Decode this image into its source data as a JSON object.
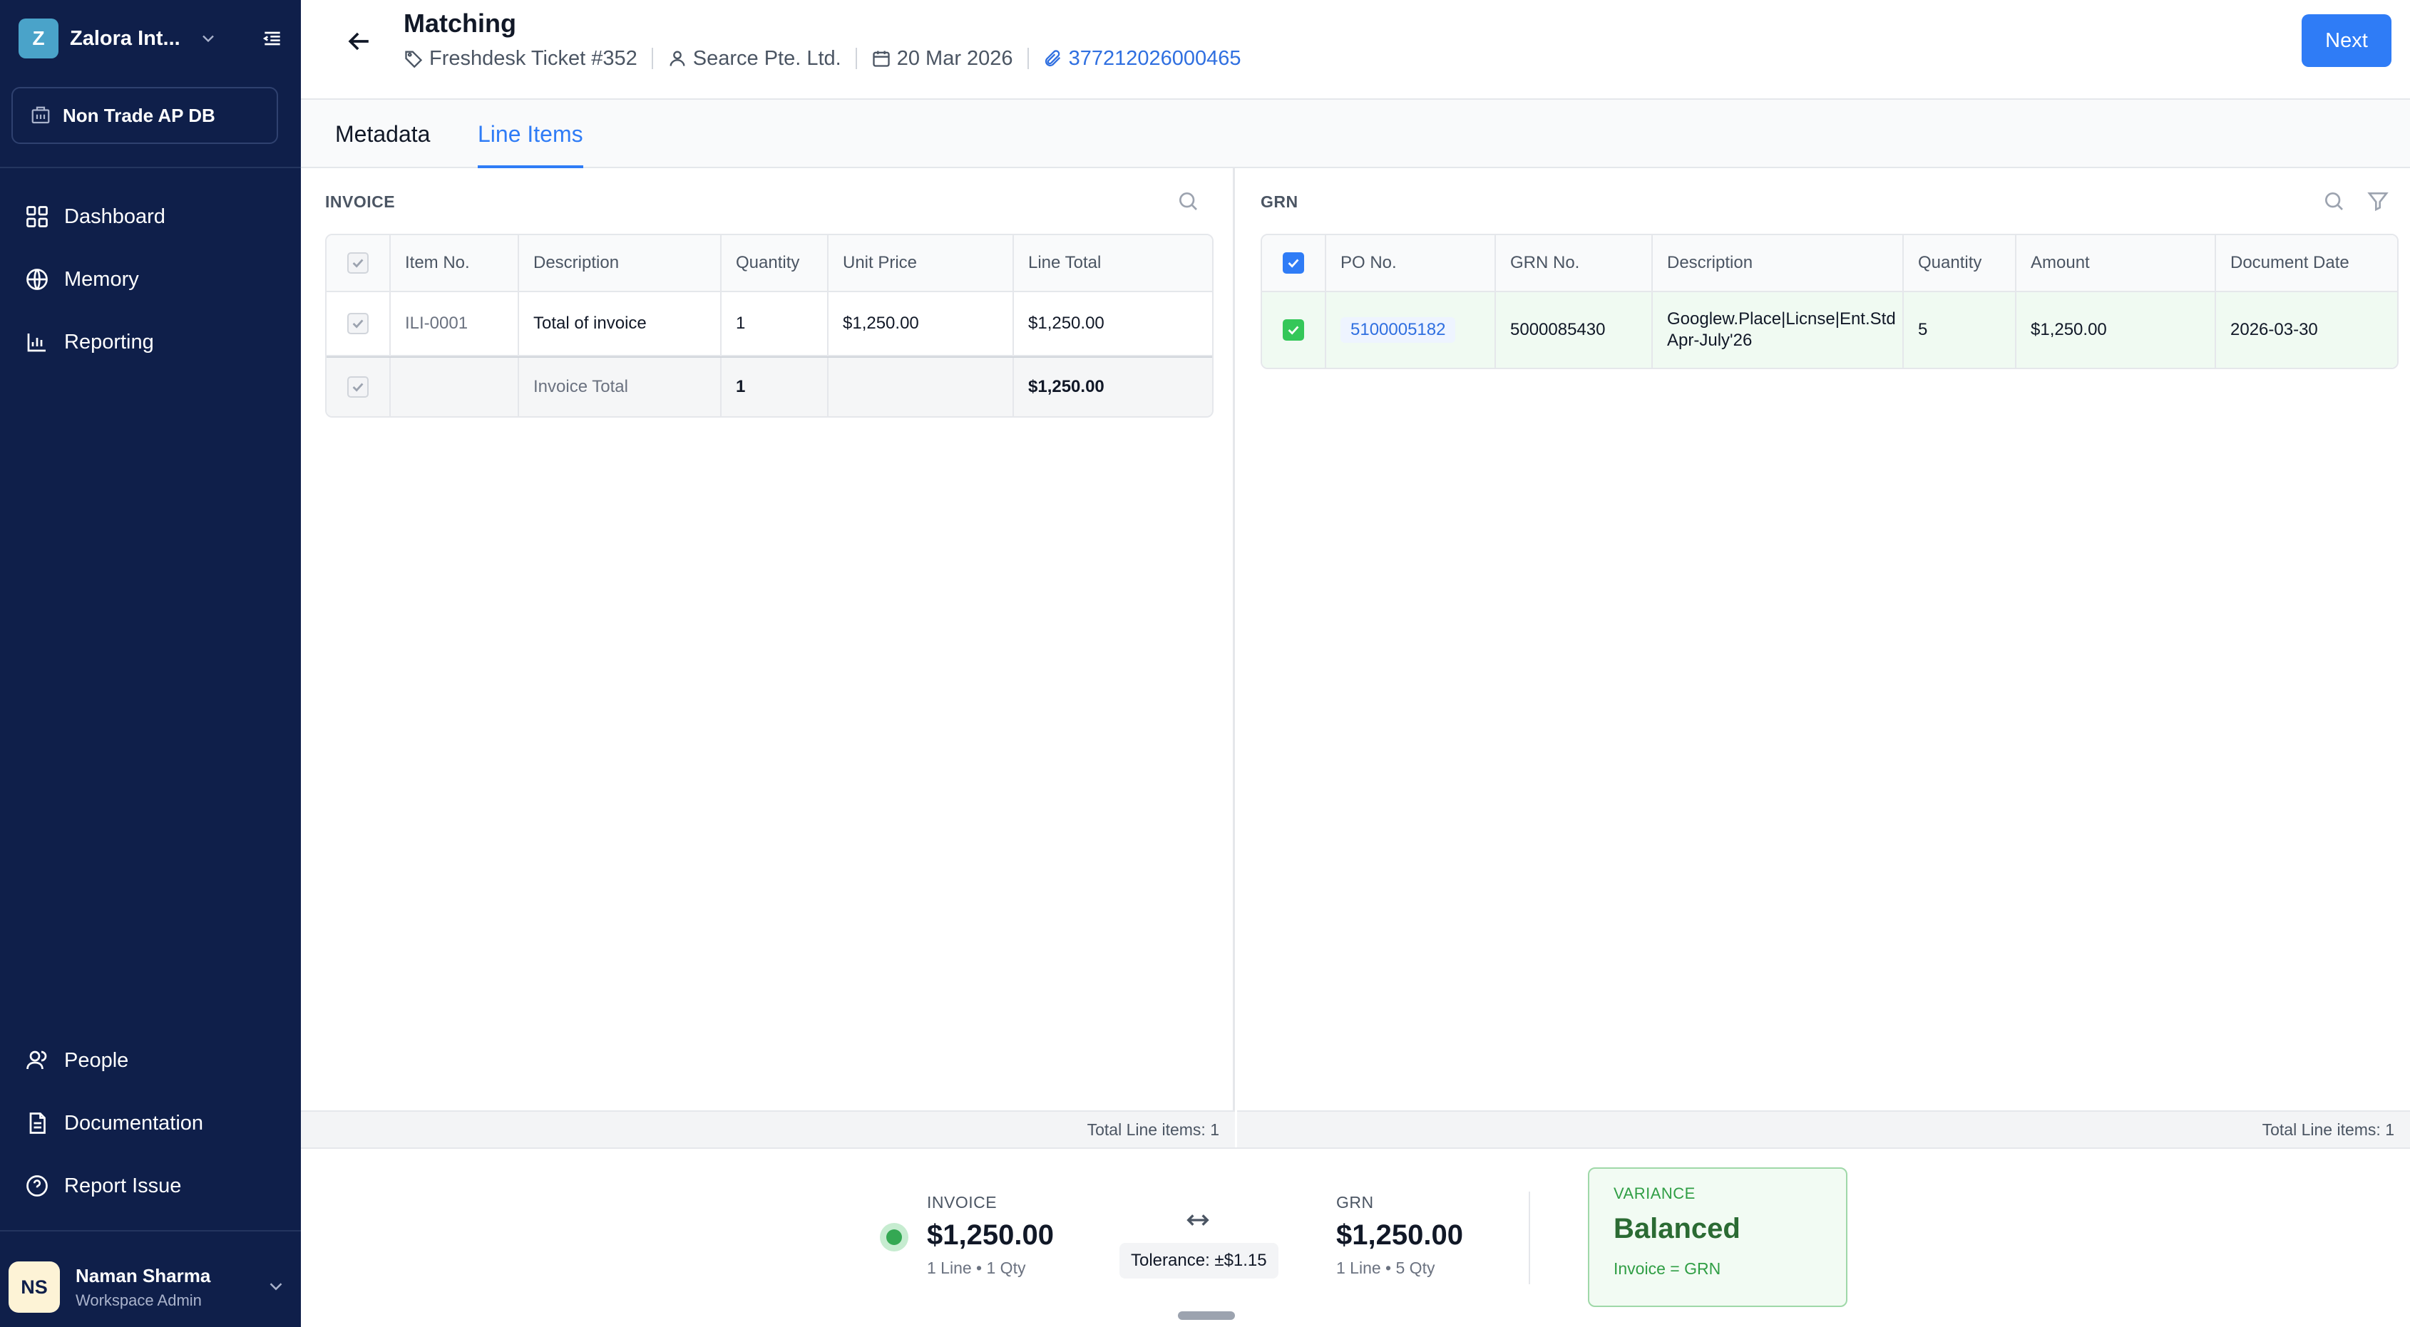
{
  "sidebar": {
    "workspace_badge": "Z",
    "workspace_name": "Zalora Int...",
    "database": "Non Trade AP DB",
    "nav": [
      {
        "label": "Dashboard",
        "icon": "dashboard-icon"
      },
      {
        "label": "Memory",
        "icon": "memory-icon"
      },
      {
        "label": "Reporting",
        "icon": "reporting-icon"
      }
    ],
    "bottom_nav": [
      {
        "label": "People",
        "icon": "people-icon"
      },
      {
        "label": "Documentation",
        "icon": "documentation-icon"
      },
      {
        "label": "Report Issue",
        "icon": "help-icon"
      }
    ],
    "user": {
      "initials": "NS",
      "name": "Naman Sharma",
      "role": "Workspace Admin"
    }
  },
  "header": {
    "title": "Matching",
    "ticket": "Freshdesk Ticket #352",
    "vendor": "Searce Pte. Ltd.",
    "date": "20 Mar 2026",
    "attachment": "377212026000465",
    "next_label": "Next"
  },
  "tabs": [
    {
      "label": "Metadata",
      "active": false
    },
    {
      "label": "Line Items",
      "active": true
    }
  ],
  "invoice_panel": {
    "label": "INVOICE",
    "columns": [
      "Item No.",
      "Description",
      "Quantity",
      "Unit Price",
      "Line Total"
    ],
    "rows": [
      {
        "item_no": "ILI-0001",
        "description": "Total of invoice",
        "quantity": "1",
        "unit_price": "$1,250.00",
        "line_total": "$1,250.00"
      }
    ],
    "total_row": {
      "label": "Invoice Total",
      "quantity": "1",
      "line_total": "$1,250.00"
    },
    "footer": "Total Line items: 1"
  },
  "grn_panel": {
    "label": "GRN",
    "columns": [
      "PO No.",
      "GRN No.",
      "Description",
      "Quantity",
      "Amount",
      "Document Date"
    ],
    "rows": [
      {
        "po_no": "5100005182",
        "grn_no": "5000085430",
        "description_line1": "Googlew.Place|Licnse|Ent.Std",
        "description_line2": "Apr-July'26",
        "quantity": "5",
        "amount": "$1,250.00",
        "document_date": "2026-03-30"
      }
    ],
    "footer": "Total Line items: 1"
  },
  "summary": {
    "invoice": {
      "label": "INVOICE",
      "amount": "$1,250.00",
      "sub": "1 Line • 1 Qty"
    },
    "tolerance": "Tolerance: ±$1.15",
    "grn": {
      "label": "GRN",
      "amount": "$1,250.00",
      "sub": "1 Line • 5 Qty"
    },
    "variance": {
      "label": "VARIANCE",
      "status": "Balanced",
      "detail": "Invoice = GRN"
    }
  },
  "colors": {
    "sidebar_bg": "#0f1f4a",
    "accent": "#2f7cf6",
    "success": "#34c759",
    "variance_text": "#2b6b33"
  }
}
